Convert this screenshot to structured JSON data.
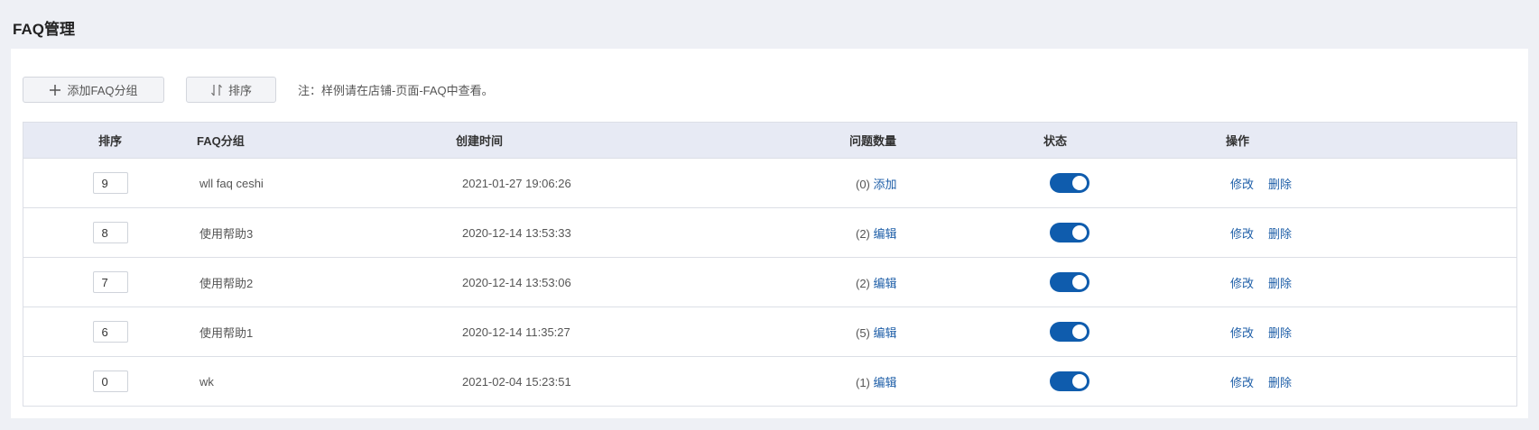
{
  "page": {
    "title": "FAQ管理"
  },
  "toolbar": {
    "add_label": "添加FAQ分组",
    "sort_label": "排序",
    "note": "注：样例请在店铺-页面-FAQ中查看。"
  },
  "table": {
    "headers": [
      "排序",
      "FAQ分组",
      "创建时间",
      "问题数量",
      "状态",
      "操作"
    ],
    "rows": [
      {
        "sort": "9",
        "group": "wll faq ceshi",
        "created": "2021-01-27 19:06:26",
        "count": "(0)",
        "count_action": "添加",
        "status_on": true,
        "edit": "修改",
        "delete": "删除"
      },
      {
        "sort": "8",
        "group": "使用帮助3",
        "created": "2020-12-14 13:53:33",
        "count": "(2)",
        "count_action": "编辑",
        "status_on": true,
        "edit": "修改",
        "delete": "删除"
      },
      {
        "sort": "7",
        "group": "使用帮助2",
        "created": "2020-12-14 13:53:06",
        "count": "(2)",
        "count_action": "编辑",
        "status_on": true,
        "edit": "修改",
        "delete": "删除"
      },
      {
        "sort": "6",
        "group": "使用帮助1",
        "created": "2020-12-14 11:35:27",
        "count": "(5)",
        "count_action": "编辑",
        "status_on": true,
        "edit": "修改",
        "delete": "删除"
      },
      {
        "sort": "0",
        "group": "wk",
        "created": "2021-02-04 15:23:51",
        "count": "(1)",
        "count_action": "编辑",
        "status_on": true,
        "edit": "修改",
        "delete": "删除"
      }
    ]
  },
  "colors": {
    "accent": "#0f5cad",
    "link": "#1f5fa8",
    "header_bg": "#e7eaf4",
    "page_bg": "#eef0f5"
  },
  "icons": {
    "add": "plus-icon",
    "sort": "sort-arrows-icon"
  }
}
